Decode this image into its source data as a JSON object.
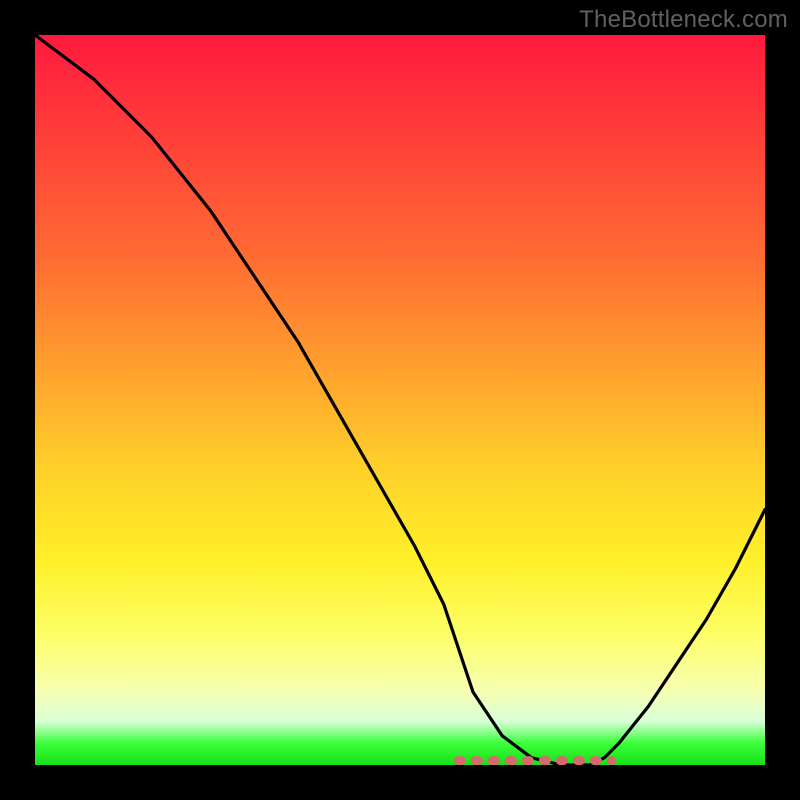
{
  "watermark": "TheBottleneck.com",
  "colors": {
    "background": "#000000",
    "gradient_top": "#ff1a3d",
    "gradient_bottom": "#18e018",
    "curve": "#000000",
    "dash": "#d46a6a"
  },
  "chart_data": {
    "type": "line",
    "title": "",
    "xlabel": "",
    "ylabel": "",
    "xlim": [
      0,
      100
    ],
    "ylim": [
      0,
      100
    ],
    "grid": false,
    "legend": false,
    "note": "Bottleneck-percentage style curve. y=100 at x=0, falls to ~0 near x≈70, flat valley x≈60–78, then rises toward ~35 at x=100. Valley floor (flat segment) drawn with a salmon dashed overlay.",
    "series": [
      {
        "name": "bottleneck-curve",
        "x": [
          0,
          4,
          8,
          12,
          16,
          20,
          24,
          28,
          32,
          36,
          40,
          44,
          48,
          52,
          56,
          58,
          60,
          64,
          68,
          72,
          76,
          78,
          80,
          84,
          88,
          92,
          96,
          100
        ],
        "y": [
          100,
          97,
          94,
          90,
          86,
          81,
          76,
          70,
          64,
          58,
          51,
          44,
          37,
          30,
          22,
          16,
          10,
          4,
          1,
          0,
          0,
          1,
          3,
          8,
          14,
          20,
          27,
          35
        ]
      }
    ],
    "valley_dash": {
      "x_start": 58,
      "x_end": 79,
      "y": 0.6
    }
  }
}
